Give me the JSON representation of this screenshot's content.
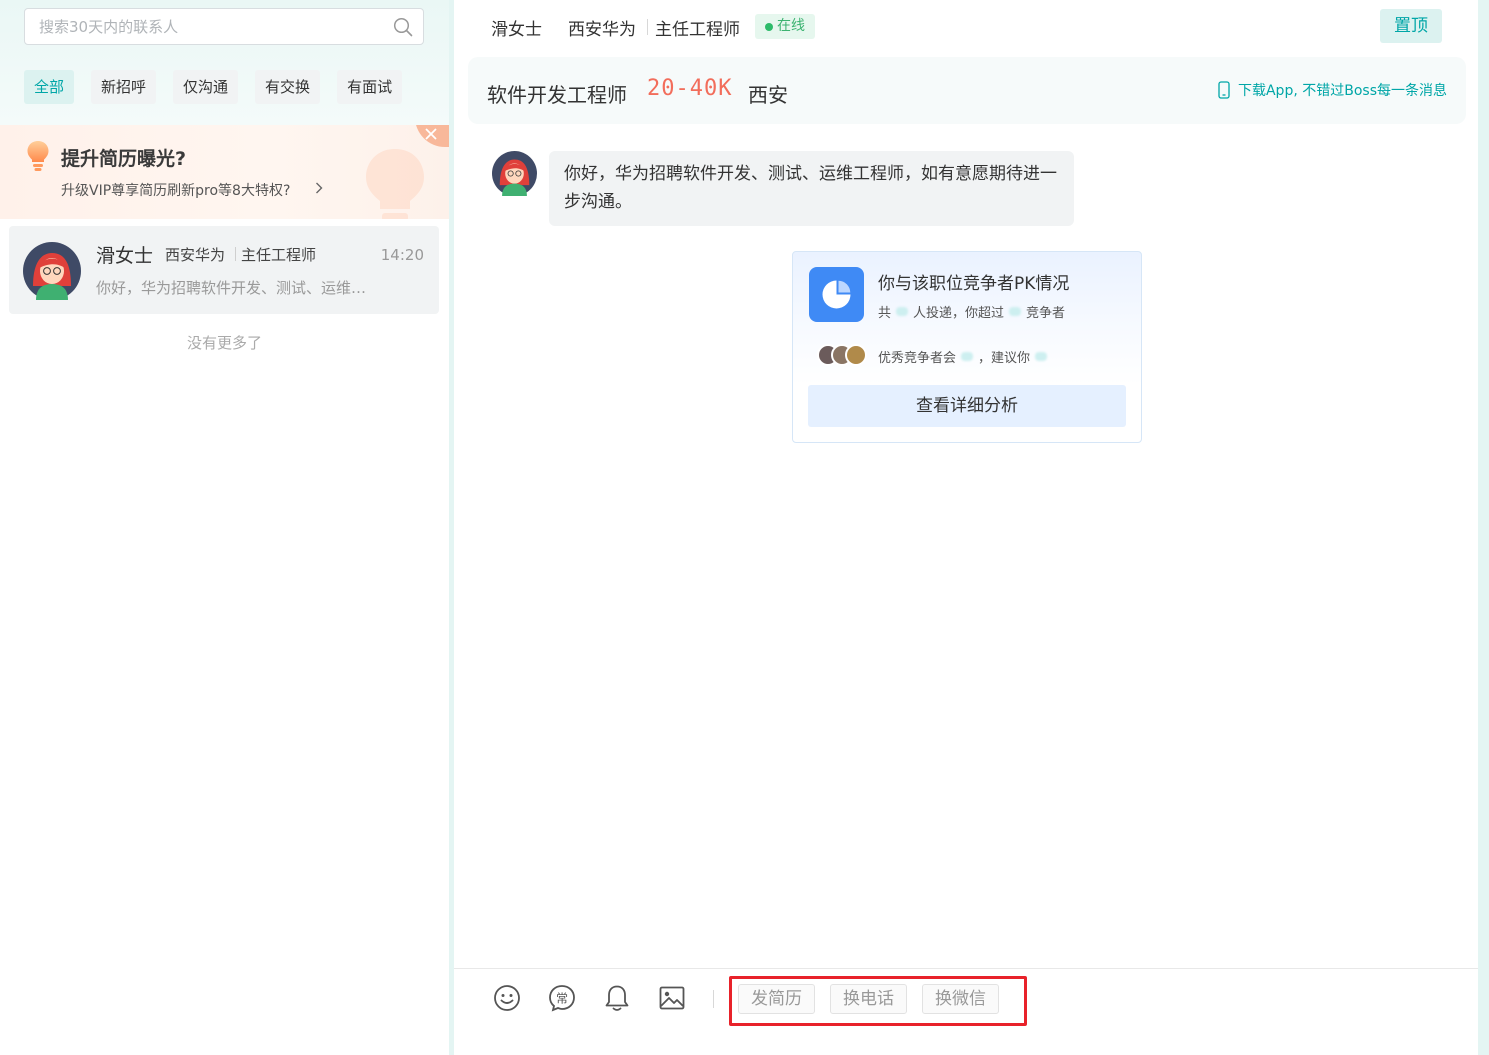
{
  "search": {
    "placeholder": "搜索30天内的联系人"
  },
  "filters": [
    {
      "label": "全部",
      "active": true
    },
    {
      "label": "新招呼"
    },
    {
      "label": "仅沟通"
    },
    {
      "label": "有交换"
    },
    {
      "label": "有面试"
    }
  ],
  "promo": {
    "title": "提升简历曝光?",
    "subtitle": "升级VIP尊享简历刷新pro等8大特权?"
  },
  "conversation": {
    "name": "滑女士",
    "company": "西安华为",
    "position": "主任工程师",
    "time": "14:20",
    "preview": "你好，华为招聘软件开发、测试、运维工程师，如有意愿期待进一步沟通。"
  },
  "list_end": "没有更多了",
  "header": {
    "name": "滑女士",
    "company": "西安华为",
    "position": "主任工程师",
    "status": "在线",
    "pin_label": "置顶"
  },
  "job": {
    "title": "软件开发工程师",
    "salary": "20-40K",
    "city": "西安",
    "app_link": "下载App, 不错过Boss每一条消息"
  },
  "message": {
    "text": "你好，华为招聘软件开发、测试、运维工程师，如有意愿期待进一步沟通。"
  },
  "pk_card": {
    "title": "你与该职位竞争者PK情况",
    "line1_a": "共",
    "line1_b": "人投递，你超过",
    "line1_c": "竞争者",
    "line2_a": "优秀竞争者会",
    "line2_b": "，建议你",
    "button": "查看详细分析"
  },
  "toolbar": {
    "icons": [
      "emoji-icon",
      "common-phrase-icon",
      "bell-icon",
      "image-icon"
    ],
    "quick_actions": [
      "发简历",
      "换电话",
      "换微信"
    ]
  },
  "colors": {
    "accent": "#00a6a7",
    "salary": "#f26d5b",
    "online": "#2dbb6a",
    "highlight": "#e8222a"
  }
}
